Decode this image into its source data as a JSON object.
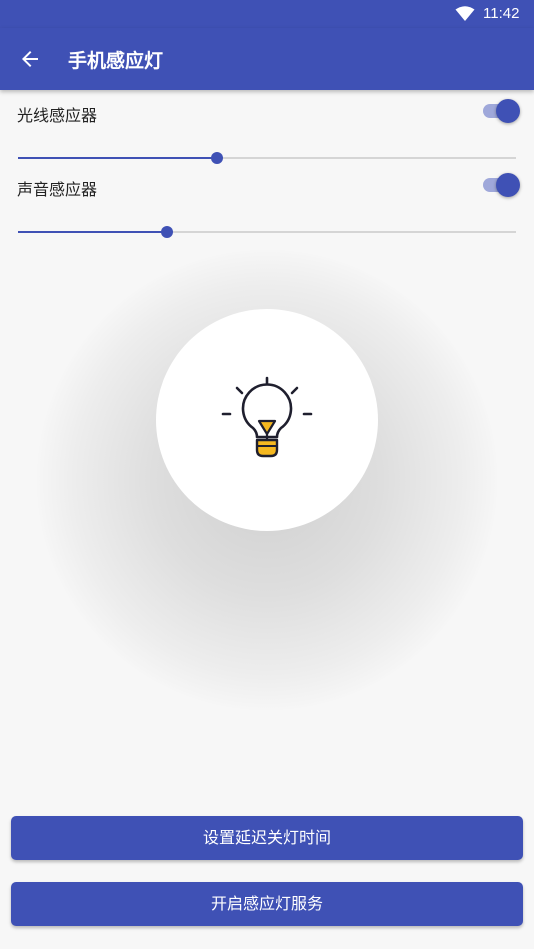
{
  "status_bar": {
    "time": "11:42",
    "wifi_icon": "wifi-icon"
  },
  "app_bar": {
    "title": "手机感应灯",
    "back_icon": "arrow-back-icon"
  },
  "light_sensor": {
    "label": "光线感应器",
    "enabled": true,
    "level": 0.4
  },
  "sound_sensor": {
    "label": "声音感应器",
    "enabled": true,
    "level": 0.3
  },
  "lamp": {
    "icon": "lightbulb-icon"
  },
  "buttons": {
    "set_delay_label": "设置延迟关灯时间",
    "start_service_label": "开启感应灯服务"
  },
  "colors": {
    "primary": "#3f51b5",
    "accent_light": "#9fa8da",
    "bulb_yellow": "#f5b820"
  }
}
